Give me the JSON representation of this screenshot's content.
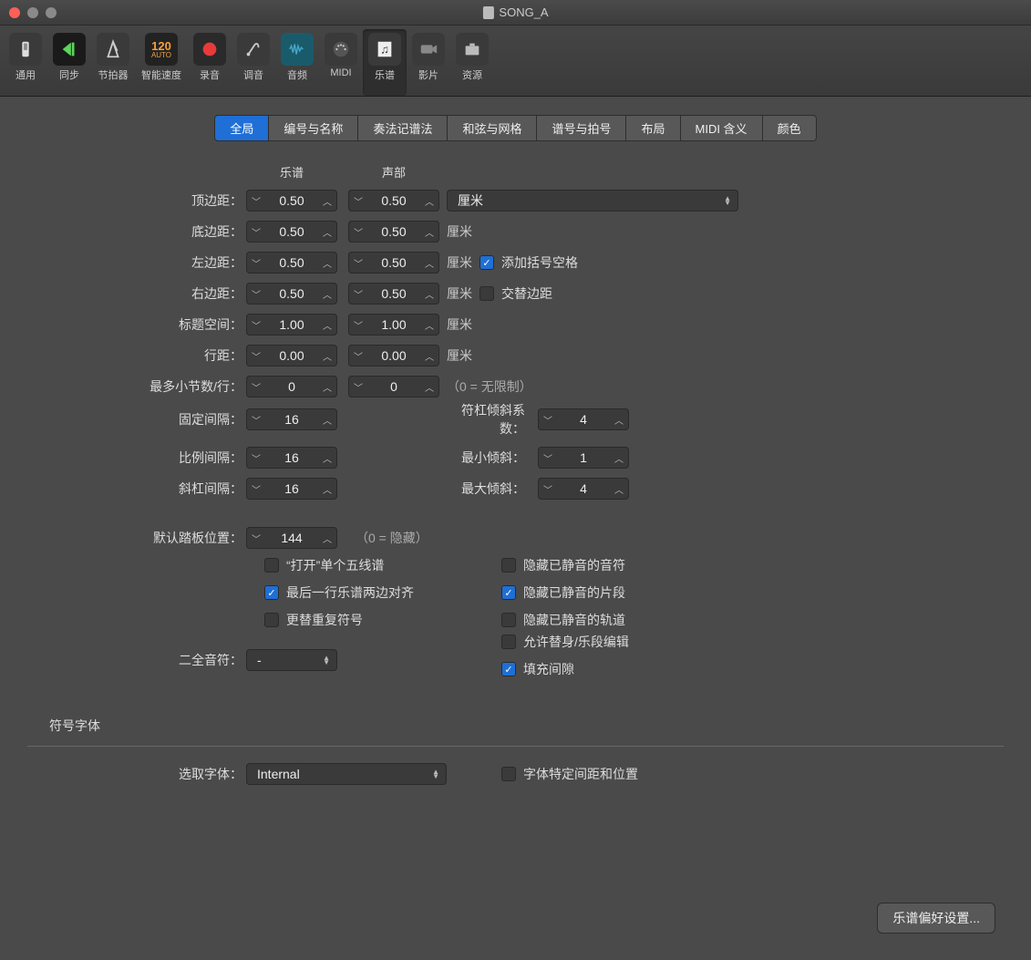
{
  "window": {
    "title": "SONG_A"
  },
  "toolbar": [
    {
      "id": "general",
      "label": "通用"
    },
    {
      "id": "sync",
      "label": "同步"
    },
    {
      "id": "metronome",
      "label": "节拍器"
    },
    {
      "id": "smarttempo",
      "label": "智能速度",
      "wide": true,
      "auto_text": "120",
      "auto_sub": "AUTO"
    },
    {
      "id": "record",
      "label": "录音"
    },
    {
      "id": "tuning",
      "label": "调音"
    },
    {
      "id": "audio",
      "label": "音频"
    },
    {
      "id": "midi",
      "label": "MIDI"
    },
    {
      "id": "score",
      "label": "乐谱",
      "selected": true
    },
    {
      "id": "movie",
      "label": "影片"
    },
    {
      "id": "assets",
      "label": "资源"
    }
  ],
  "subtabs": [
    "全局",
    "编号与名称",
    "奏法记谱法",
    "和弦与网格",
    "谱号与拍号",
    "布局",
    "MIDI 含义",
    "颜色"
  ],
  "subtab_active": 0,
  "columns": {
    "score": "乐谱",
    "part": "声部"
  },
  "rows": {
    "top": {
      "label": "顶边距：",
      "a": "0.50",
      "b": "0.50",
      "unit_select": "厘米"
    },
    "bottom": {
      "label": "底边距：",
      "a": "0.50",
      "b": "0.50",
      "unit": "厘米"
    },
    "left": {
      "label": "左边距：",
      "a": "0.50",
      "b": "0.50",
      "unit": "厘米",
      "check": "添加括号空格",
      "check_on": true
    },
    "right": {
      "label": "右边距：",
      "a": "0.50",
      "b": "0.50",
      "unit": "厘米",
      "check": "交替边距",
      "check_on": false
    },
    "header": {
      "label": "标题空间：",
      "a": "1.00",
      "b": "1.00",
      "unit": "厘米"
    },
    "line": {
      "label": "行距：",
      "a": "0.00",
      "b": "0.00",
      "unit": "厘米"
    },
    "bars": {
      "label": "最多小节数/行：",
      "a": "0",
      "b": "0",
      "hint": "（0 = 无限制）"
    }
  },
  "spacing": {
    "fixed": {
      "label": "固定间隔：",
      "val": "16"
    },
    "prop": {
      "label": "比例间隔：",
      "val": "16"
    },
    "slash": {
      "label": "斜杠间隔：",
      "val": "16"
    },
    "beam_slant": {
      "label": "符杠倾斜系数：",
      "val": "4"
    },
    "min_slant": {
      "label": "最小倾斜：",
      "val": "1"
    },
    "max_slant": {
      "label": "最大倾斜：",
      "val": "4"
    }
  },
  "pedal": {
    "label": "默认踏板位置：",
    "val": "144",
    "hint": "（0 = 隐藏）"
  },
  "checks_left": [
    {
      "label": "“打开”单个五线谱",
      "on": false
    },
    {
      "label": "最后一行乐谱两边对齐",
      "on": true
    },
    {
      "label": "更替重复符号",
      "on": false
    }
  ],
  "checks_right": [
    {
      "label": "隐藏已静音的音符",
      "on": false
    },
    {
      "label": "隐藏已静音的片段",
      "on": true
    },
    {
      "label": "隐藏已静音的轨道",
      "on": false
    }
  ],
  "checks_right2": [
    {
      "label": "允许替身/乐段编辑",
      "on": false
    },
    {
      "label": "填充间隙",
      "on": true
    }
  ],
  "double_whole": {
    "label": "二全音符：",
    "value": "-"
  },
  "font_section": "符号字体",
  "font": {
    "label": "选取字体：",
    "value": "Internal",
    "check": "字体特定间距和位置",
    "check_on": false
  },
  "footer_button": "乐谱偏好设置..."
}
